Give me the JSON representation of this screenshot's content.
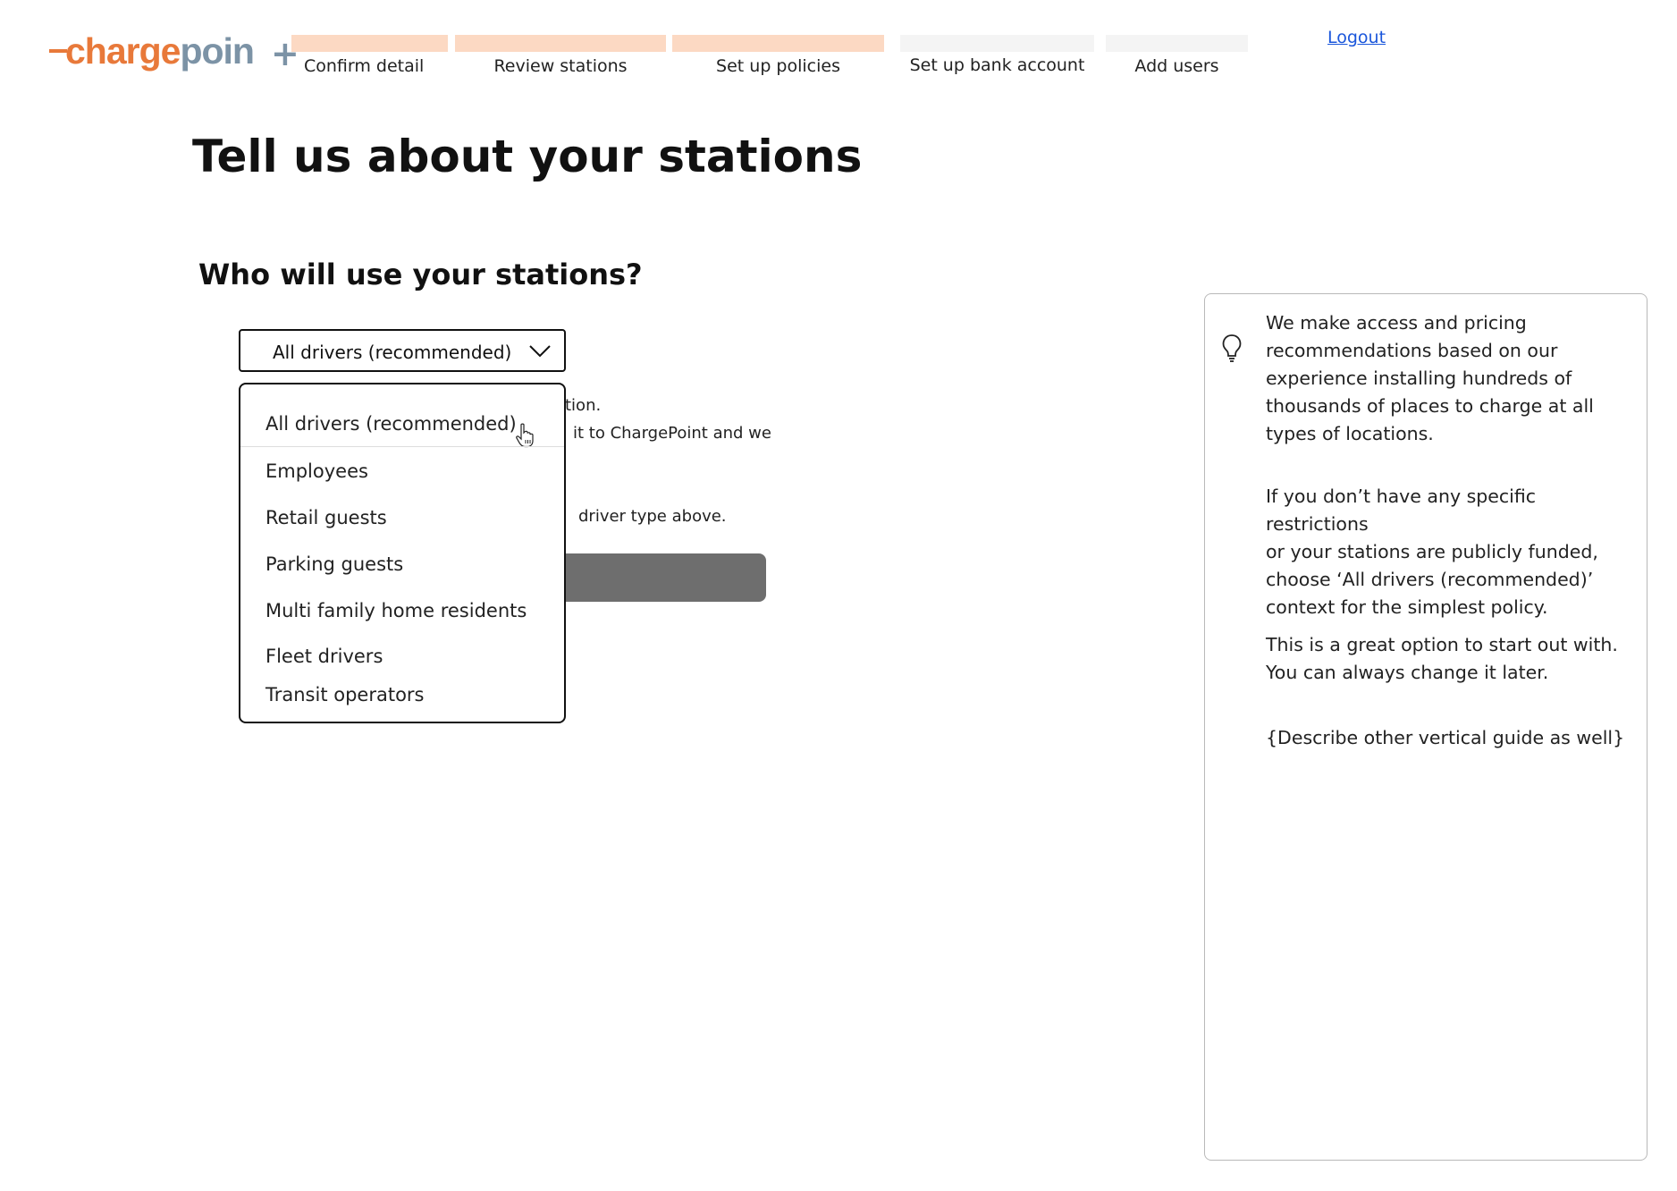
{
  "brand": {
    "logo_part1": "charge",
    "logo_part2": "poin",
    "logo_plus": "+",
    "colors": {
      "orange": "#e8793a",
      "slate": "#7c93a6"
    }
  },
  "stepper": {
    "steps": [
      {
        "label": "Confirm detail",
        "state": "completed",
        "color": "#fcd9c3"
      },
      {
        "label": "Review stations",
        "state": "completed",
        "color": "#fcd9c3"
      },
      {
        "label": "Set up policies",
        "state": "current",
        "color": "#fcd9c3"
      },
      {
        "label": "Set up bank account",
        "state": "upcoming",
        "color": "#f4f4f4"
      },
      {
        "label": "Add users",
        "state": "upcoming",
        "color": "#f4f4f4"
      }
    ]
  },
  "header": {
    "logout_label": "Logout"
  },
  "main": {
    "title": "Tell us about your stations",
    "question": "Who will use your stations?",
    "hidden_text": {
      "line1": "tion.",
      "line2": "it to ChargePoint and we",
      "line3": "driver type above."
    },
    "select": {
      "selected_value": "All drivers (recommended)",
      "options": [
        "All drivers (recommended)",
        "Employees",
        "Retail guests",
        "Parking guests",
        "Multi family home residents",
        "Fleet drivers",
        "Transit operators"
      ]
    }
  },
  "tip": {
    "icon": "lightbulb-icon",
    "paragraphs": [
      "We make access and pricing\nrecommendations based on our\nexperience installing hundreds of\nthousands of places to charge at all\ntypes of locations.",
      "If you don’t have any specific restrictions\nor your stations are publicly funded,\nchoose ‘All drivers (recommended)’\ncontext for the simplest policy.",
      "This is a great option to start out with.\nYou can always change it later.",
      "{Describe other vertical guide as well}"
    ]
  }
}
